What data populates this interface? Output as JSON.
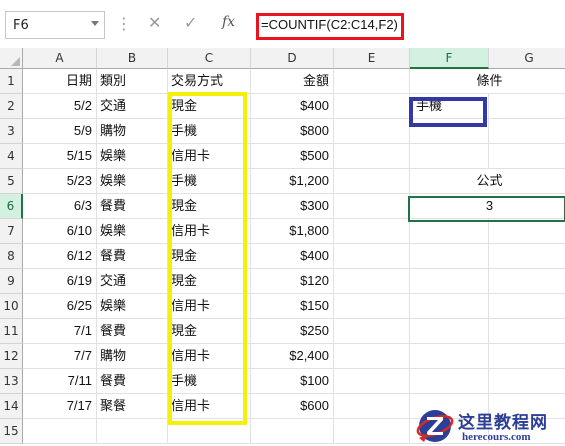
{
  "formula_bar": {
    "name_box": "F6",
    "cancel_icon": "✕",
    "enter_icon": "✓",
    "fx_label": "fx",
    "formula": "=COUNTIF(C2:C14,F2)"
  },
  "columns": [
    "A",
    "B",
    "C",
    "D",
    "E",
    "F",
    "G"
  ],
  "selected_column": "F",
  "row_numbers": [
    "1",
    "2",
    "3",
    "4",
    "5",
    "6",
    "7",
    "8",
    "9",
    "10",
    "11",
    "12",
    "13",
    "14",
    "15"
  ],
  "selected_row": "6",
  "headers": {
    "date": "日期",
    "category": "類別",
    "payment": "交易方式",
    "amount": "金額"
  },
  "rows": [
    {
      "date": "5/2",
      "category": "交通",
      "payment": "現金",
      "amount": "$400"
    },
    {
      "date": "5/9",
      "category": "購物",
      "payment": "手機",
      "amount": "$800"
    },
    {
      "date": "5/15",
      "category": "娛樂",
      "payment": "信用卡",
      "amount": "$500"
    },
    {
      "date": "5/23",
      "category": "娛樂",
      "payment": "手機",
      "amount": "$1,200"
    },
    {
      "date": "6/3",
      "category": "餐費",
      "payment": "現金",
      "amount": "$300"
    },
    {
      "date": "6/10",
      "category": "娛樂",
      "payment": "信用卡",
      "amount": "$1,800"
    },
    {
      "date": "6/12",
      "category": "餐費",
      "payment": "現金",
      "amount": "$400"
    },
    {
      "date": "6/19",
      "category": "交通",
      "payment": "現金",
      "amount": "$120"
    },
    {
      "date": "6/25",
      "category": "娛樂",
      "payment": "信用卡",
      "amount": "$150"
    },
    {
      "date": "7/1",
      "category": "餐費",
      "payment": "現金",
      "amount": "$250"
    },
    {
      "date": "7/7",
      "category": "購物",
      "payment": "信用卡",
      "amount": "$2,400"
    },
    {
      "date": "7/11",
      "category": "餐費",
      "payment": "手機",
      "amount": "$100"
    },
    {
      "date": "7/17",
      "category": "聚餐",
      "payment": "信用卡",
      "amount": "$600"
    }
  ],
  "side": {
    "condition_label": "條件",
    "condition_value": "手機",
    "formula_label": "公式",
    "result_value": "3"
  },
  "highlight_colors": {
    "range": "#f6ef0a",
    "criteria": "#3437a6",
    "formula": "#e8151f",
    "selection": "#217346"
  },
  "watermark": {
    "title": "这里教程网",
    "url": "herecours.com",
    "icon": "z-globe-logo"
  }
}
